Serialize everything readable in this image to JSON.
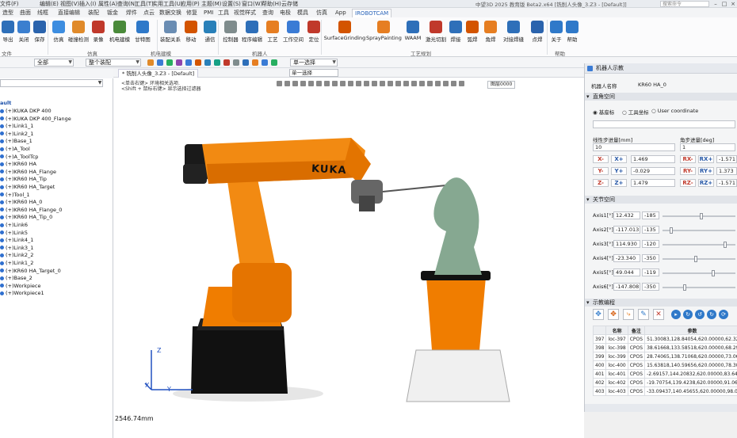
{
  "titlebar": {
    "menus": [
      "文件(F)",
      "编辑(E)",
      "视图(V)",
      "插入(I)",
      "属性(A)",
      "查询(N)",
      "工具(T)",
      "实用工具(U)",
      "应用(P)",
      "主题(M)",
      "设置(S)",
      "窗口(W)",
      "帮助(H)",
      "云存储"
    ],
    "title": "中望3D  2025 教育版  Beta2.x64   [铣削人头像_3.Z3 - [Default]]",
    "search_placeholder": "搜索命令"
  },
  "ribbon_tabs": [
    "造型",
    "曲面",
    "线框",
    "直接编辑",
    "装配",
    "钣金",
    "焊件",
    "点云",
    "数据交换",
    "修复",
    "PMI",
    "工具",
    "视觉样式",
    "查询",
    "电极",
    "模具",
    "仿真",
    "App",
    "IROBOTCAM"
  ],
  "active_tab_index": 18,
  "ribbon": {
    "buttons": [
      {
        "label": "导出",
        "icon": "export-icon",
        "color": "#2e6fb9"
      },
      {
        "label": "关闭",
        "icon": "close-file-icon",
        "color": "#3b7fcf"
      },
      {
        "label": "保存",
        "icon": "save-icon",
        "color": "#2a63ad"
      },
      {
        "label": "仿真",
        "icon": "simulate-icon",
        "color": "#3d8de0"
      },
      {
        "label": "碰撞检测",
        "icon": "collision-icon",
        "color": "#e08a2a"
      },
      {
        "label": "录像",
        "icon": "record-icon",
        "color": "#c0392b"
      },
      {
        "label": "机电建模",
        "icon": "mechatronic-icon",
        "color": "#4a8a3a"
      },
      {
        "label": "甘特图",
        "icon": "gantt-icon",
        "color": "#2f79c9"
      },
      {
        "label": "装配关系",
        "icon": "assembly-relation-icon",
        "color": "#6a8db3"
      },
      {
        "label": "移动",
        "icon": "move-icon",
        "color": "#d35400"
      },
      {
        "label": "通信",
        "icon": "communication-icon",
        "color": "#2980b9"
      },
      {
        "label": "控制器",
        "icon": "controller-icon",
        "color": "#7f8c8d"
      },
      {
        "label": "程序编辑",
        "icon": "program-edit-icon",
        "color": "#2e6fb9"
      },
      {
        "label": "工艺",
        "icon": "process-icon",
        "color": "#e67e22"
      },
      {
        "label": "工作空间",
        "icon": "workspace-icon",
        "color": "#3a7bd5"
      },
      {
        "label": "定位",
        "icon": "locate-icon",
        "color": "#c0392b"
      },
      {
        "label": "SurfaceGrinding",
        "icon": "surface-grinding-icon",
        "color": "#d35400"
      },
      {
        "label": "SprayPainting",
        "icon": "spray-painting-icon",
        "color": "#e67e22"
      },
      {
        "label": "WAAM",
        "icon": "waam-icon",
        "color": "#2e6fb9"
      },
      {
        "label": "激光切割",
        "icon": "laser-cut-icon",
        "color": "#c0392b"
      },
      {
        "label": "焊接",
        "icon": "weld-icon",
        "color": "#2e6fb9"
      },
      {
        "label": "弧焊",
        "icon": "arc-weld-icon",
        "color": "#d35400"
      },
      {
        "label": "角焊",
        "icon": "fillet-weld-icon",
        "color": "#e67e22"
      },
      {
        "label": "对接焊缝",
        "icon": "butt-weld-icon",
        "color": "#2e6fb9"
      },
      {
        "label": "点焊",
        "icon": "spot-weld-icon",
        "color": "#2a63ad"
      },
      {
        "label": "关于",
        "icon": "about-icon",
        "color": "#2f79c9"
      },
      {
        "label": "帮助",
        "icon": "help-icon",
        "color": "#2f79c9"
      }
    ],
    "groups": [
      "文件",
      "仿真",
      "机电建模",
      "机器人",
      "工艺规划",
      "帮助"
    ]
  },
  "toolbar": {
    "filter_all": "全部",
    "assembly_scope": "整个装配",
    "select_mode": "单一选择"
  },
  "tree": {
    "root": "ault",
    "items": [
      "(+)KUKA DKP 400",
      "(+)KUKA DKP 400_Flange",
      "(+)Link1_1",
      "(+)Link2_1",
      "(+)Base_1",
      "(+)A_Tool",
      "(+)A_ToolTcp",
      "(+)KR60 HA",
      "(+)KR60 HA_Flange",
      "(+)KR60 HA_Tip",
      "(+)KR60 HA_Target",
      "(+)Tool_1",
      "(+)KR60 HA_0",
      "(+)KR60 HA_Flange_0",
      "(+)KR60 HA_Tip_0",
      "(+)Link6",
      "(+)Link5",
      "(+)Link4_1",
      "(+)Link3_1",
      "(+)Link2_2",
      "(+)Link1_2",
      "(+)KR60 HA_Target_0",
      "(+)Base_2",
      "(+)Workpiece",
      "(+)Workpiece1"
    ]
  },
  "viewport": {
    "tab": "* 铣削人头像_3.Z3 - [Default]",
    "hint_line1": "<单击右键> 环境相关选项.",
    "hint_line2": "<Shift + 鼠标右键> 显示选择过滤器",
    "color_label": "图层0000",
    "distance": "2546.74mm",
    "robot_brand": "KUKA",
    "axis_x": "X",
    "axis_y": "Y",
    "axis_z": "Z"
  },
  "robot_panel": {
    "title": "机器人示教",
    "robot_name_label": "机器人名称",
    "robot_name": "KR60 HA_0",
    "cart_section": "直角空间",
    "coord_base": "基座标",
    "coord_tool": "工具坐标",
    "coord_user": "User coordinate",
    "linear_step_label": "线性步进量[mm]",
    "angle_step_label": "角步进量[deg]",
    "linear_step": "10",
    "angle_step": "1",
    "xyz": [
      {
        "minus": "X-",
        "plus": "X+",
        "value": "1.469",
        "rminus": "RX-",
        "rplus": "RX+",
        "rvalue": "-1.571"
      },
      {
        "minus": "Y-",
        "plus": "Y+",
        "value": "-0.029",
        "rminus": "RY-",
        "rplus": "RY+",
        "rvalue": "1.373"
      },
      {
        "minus": "Z-",
        "plus": "Z+",
        "value": "1.479",
        "rminus": "RZ-",
        "rplus": "RZ+",
        "rvalue": "-1.571"
      }
    ],
    "joint_section": "关节空间",
    "axes": [
      {
        "label": "Axis1[°]",
        "value": "12.432",
        "min": "-185",
        "level": 0.53
      },
      {
        "label": "Axis2[°]",
        "value": "-117.013",
        "min": "-135",
        "level": 0.1
      },
      {
        "label": "Axis3[°]",
        "value": "114.930",
        "min": "-120",
        "level": 0.88
      },
      {
        "label": "Axis4[°]",
        "value": "-23.340",
        "min": "-350",
        "level": 0.45
      },
      {
        "label": "Axis5[°]",
        "value": "49.044",
        "min": "-119",
        "level": 0.71
      },
      {
        "label": "Axis6[°]",
        "value": "-147.808",
        "min": "-350",
        "level": 0.29
      }
    ],
    "program_section": "示教编程",
    "table_headers": [
      "",
      "名称",
      "备注",
      "参数"
    ],
    "rows": [
      [
        "397",
        "loc-397",
        "CPOS",
        "51.30083,128.84054,620.00000,62.3297"
      ],
      [
        "398",
        "loc-398",
        "CPOS",
        "38.61668,133.58518,620.00000,68.2957"
      ],
      [
        "399",
        "loc-399",
        "CPOS",
        "28.74065,138.71068,620.00000,73.0680"
      ],
      [
        "400",
        "loc-400",
        "CPOS",
        "15.63818,140.59656,620.00000,78.3010"
      ],
      [
        "401",
        "loc-401",
        "CPOS",
        "-2.69157,144.20832,620.00000,83.6492"
      ],
      [
        "402",
        "loc-402",
        "CPOS",
        "-19.70754,139.4238,620.00000,91.0687"
      ],
      [
        "403",
        "loc-403",
        "CPOS",
        "-33.09437,140.45655,620.00000,98.043"
      ]
    ]
  }
}
